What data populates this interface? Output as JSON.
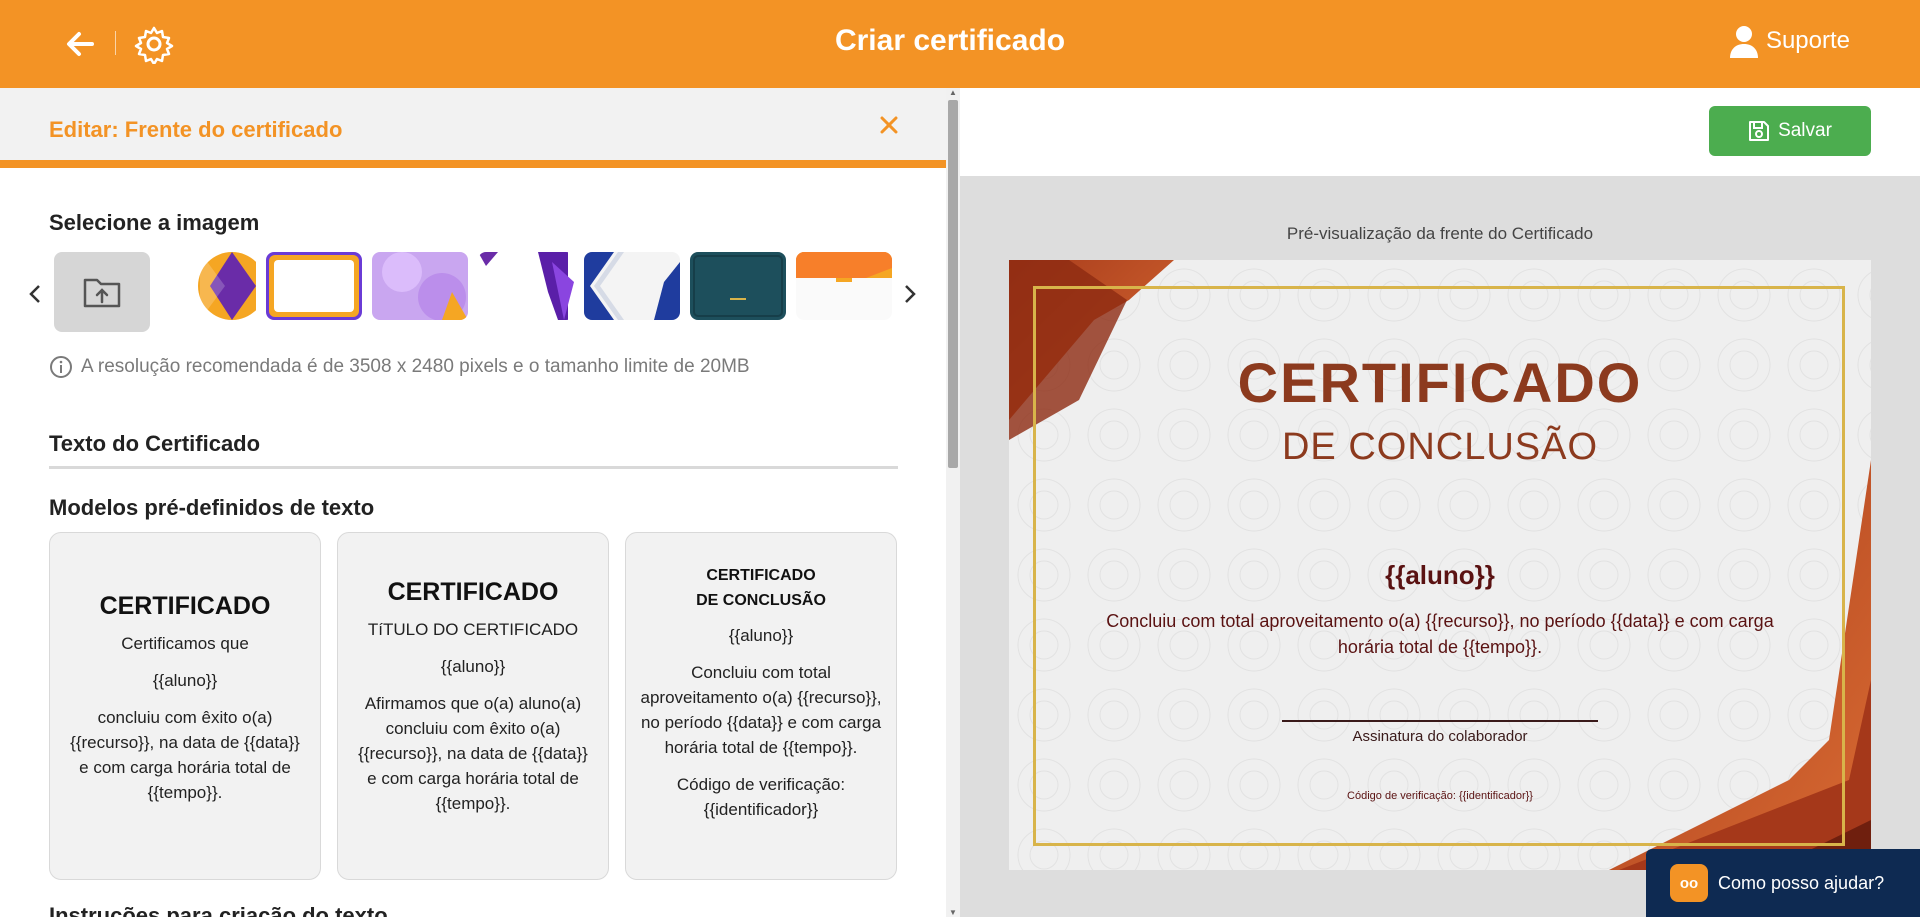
{
  "header": {
    "title": "Criar certificado",
    "support_label": "Suporte"
  },
  "editor": {
    "panel_title": "Editar: Frente do certificado",
    "image_section_title": "Selecione a imagem",
    "image_hint": "A resolução recomendada é de 3508 x 2480 pixels e o tamanho limite de 20MB",
    "text_section_title": "Texto do Certificado",
    "models_title": "Modelos pré-definidos de texto",
    "instructions_title": "Instruções para criação do texto"
  },
  "models": [
    {
      "title": "CERTIFICADO",
      "lines": [
        "Certificamos que",
        "{{aluno}}",
        "concluiu com êxito o(a) {{recurso}}, na data de {{data}} e com carga horária total de {{tempo}}."
      ]
    },
    {
      "title": "CERTIFICADO",
      "lines": [
        "TíTULO DO CERTIFICADO",
        "{{aluno}}",
        "Afirmamos que o(a) aluno(a) concluiu com êxito o(a) {{recurso}}, na data de {{data}} e com carga horária total de {{tempo}}."
      ]
    },
    {
      "title_line1": "CERTIFICADO",
      "title_line2": "DE CONCLUSÃO",
      "lines": [
        "{{aluno}}",
        "Concluiu com total aproveitamento o(a) {{recurso}}, no período {{data}} e com carga horária total de {{tempo}}.",
        "Código de verificação: {{identificador}}"
      ]
    }
  ],
  "preview": {
    "save_label": "Salvar",
    "label": "Pré-visualização da frente do Certificado",
    "cert_title": "CERTIFICADO",
    "cert_subtitle": "DE CONCLUSÃO",
    "cert_name": "{{aluno}}",
    "cert_body": "Concluiu com total aproveitamento o(a) {{recurso}}, no período {{data}} e com carga horária total de {{tempo}}.",
    "signature_label": "Assinatura do colaborador",
    "code_label": "Código de verificação: {{identificador}}"
  },
  "help_widget": {
    "label": "Como posso ajudar?",
    "icon_text": "oo"
  },
  "colors": {
    "brand_orange": "#f39325",
    "save_green": "#4cad4f",
    "help_navy": "#0e2a52",
    "cert_rust": "#8c3a1e"
  }
}
